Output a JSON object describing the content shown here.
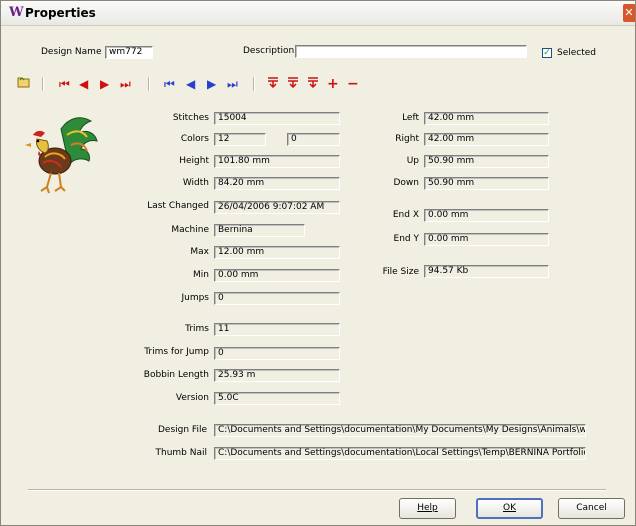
{
  "window": {
    "title": "Properties",
    "close_glyph": "✕"
  },
  "header": {
    "design_name_label": "Design Name",
    "design_name_value": "wm772",
    "description_label": "Description",
    "description_value": "",
    "selected_label": "Selected",
    "selected_checked": true
  },
  "toolbar": {
    "icons": [
      "open-folder-icon",
      "first-red-icon",
      "prev-red-icon",
      "next-red-icon",
      "last-red-icon",
      "first-blue-icon",
      "prev-blue-icon",
      "next-blue-icon",
      "last-blue-icon",
      "stitch-a-icon",
      "stitch-b-icon",
      "stitch-c-icon",
      "add-icon",
      "remove-icon"
    ]
  },
  "left_fields": {
    "stitches": {
      "label": "Stitches",
      "value": "15004"
    },
    "colors": {
      "label": "Colors",
      "value": "12",
      "value2": "0"
    },
    "height": {
      "label": "Height",
      "value": "101.80 mm"
    },
    "width": {
      "label": "Width",
      "value": "84.20 mm"
    },
    "last_changed": {
      "label": "Last Changed",
      "value": "26/04/2006 9:07:02 AM"
    },
    "machine": {
      "label": "Machine",
      "value": "Bernina"
    },
    "max": {
      "label": "Max",
      "value": "12.00 mm"
    },
    "min": {
      "label": "Min",
      "value": "0.00 mm"
    },
    "jumps": {
      "label": "Jumps",
      "value": "0"
    },
    "trims": {
      "label": "Trims",
      "value": "11"
    },
    "trims_for_jump": {
      "label": "Trims for Jump",
      "value": "0"
    },
    "bobbin_length": {
      "label": "Bobbin Length",
      "value": "25.93 m"
    },
    "version": {
      "label": "Version",
      "value": "5.0C"
    }
  },
  "right_fields": {
    "left": {
      "label": "Left",
      "value": "42.00 mm"
    },
    "right": {
      "label": "Right",
      "value": "42.00 mm"
    },
    "up": {
      "label": "Up",
      "value": "50.90 mm"
    },
    "down": {
      "label": "Down",
      "value": "50.90 mm"
    },
    "end_x": {
      "label": "End X",
      "value": "0.00 mm"
    },
    "end_y": {
      "label": "End Y",
      "value": "0.00 mm"
    },
    "file_size": {
      "label": "File Size",
      "value": "94.57 Kb"
    }
  },
  "files": {
    "design_file": {
      "label": "Design File",
      "value": "C:\\Documents and Settings\\documentation\\My Documents\\My Designs\\Animals\\wm"
    },
    "thumb_nail": {
      "label": "Thumb Nail",
      "value": "C:\\Documents and Settings\\documentation\\Local Settings\\Temp\\BERNINA Portfolio"
    }
  },
  "buttons": {
    "help": "Help",
    "ok": "OK",
    "cancel": "Cancel"
  },
  "colors": {
    "accent_red": "#d01010",
    "accent_blue": "#2a3fcf",
    "dialog_bg": "#f1efe2",
    "title_icon": "#6a1e8a"
  }
}
